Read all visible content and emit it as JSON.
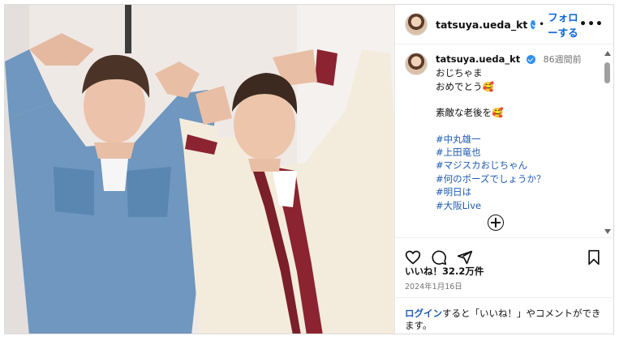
{
  "post": {
    "username": "tatsuya.ueda_kt",
    "follow_label": "フォローする",
    "more_label": "•••",
    "dot": "•"
  },
  "caption": {
    "username": "tatsuya.ueda_kt",
    "time": "86週間前",
    "lines": [
      "おじちゃま",
      "おめでとう🥰",
      "",
      "素敵な老後を🥰"
    ],
    "hashtags": [
      "#中丸雄一",
      "#上田竜也",
      "#マジスカおじちゃん",
      "#何のポーズでしょうか？",
      "#明日は",
      "#大阪Live"
    ]
  },
  "stats": {
    "likes": "いいね！32.2万件",
    "date": "2024年1月16日"
  },
  "login_prompt": {
    "link": "ログイン",
    "text": "すると「いいね！」やコメントができます。"
  },
  "icons": [
    "heart-icon",
    "comment-icon",
    "share-icon",
    "bookmark-icon",
    "add-comment-icon",
    "verified-icon",
    "more-options-icon"
  ]
}
